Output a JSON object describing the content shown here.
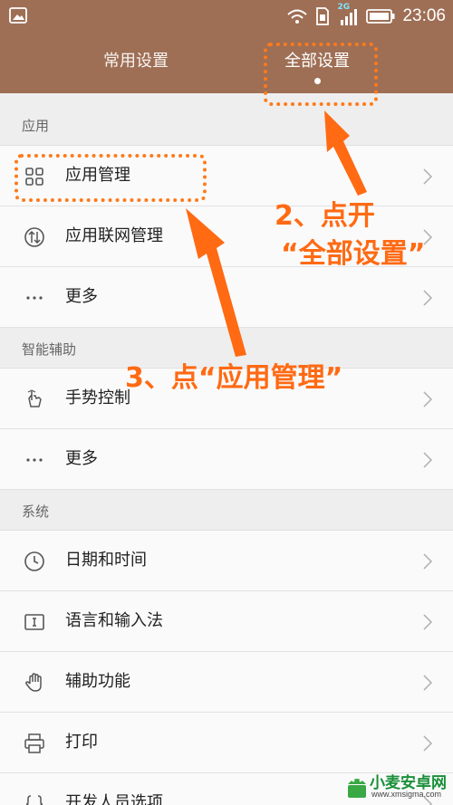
{
  "status": {
    "time": "23:06",
    "network": "2G"
  },
  "tabs": [
    {
      "label": "常用设置"
    },
    {
      "label": "全部设置"
    }
  ],
  "sections": [
    {
      "title": "应用",
      "items": [
        {
          "label": "应用管理",
          "icon": "grid-icon"
        },
        {
          "label": "应用联网管理",
          "icon": "network-arrows-icon"
        },
        {
          "label": "更多",
          "icon": "more-dots-icon"
        }
      ]
    },
    {
      "title": "智能辅助",
      "items": [
        {
          "label": "手势控制",
          "icon": "gesture-hand-icon"
        },
        {
          "label": "更多",
          "icon": "more-dots-icon"
        }
      ]
    },
    {
      "title": "系统",
      "items": [
        {
          "label": "日期和时间",
          "icon": "clock-icon"
        },
        {
          "label": "语言和输入法",
          "icon": "keyboard-icon"
        },
        {
          "label": "辅助功能",
          "icon": "hand-icon"
        },
        {
          "label": "打印",
          "icon": "printer-icon"
        },
        {
          "label": "开发人员选项",
          "icon": "braces-icon"
        }
      ]
    }
  ],
  "annotations": {
    "step2_line1": "2、点开",
    "step2_line2": "“全部设置”",
    "step3": "3、点“应用管理”",
    "accent_color": "#ff6a13"
  },
  "watermark": {
    "name": "小麦安卓网",
    "url": "www.xmsigma.com"
  }
}
